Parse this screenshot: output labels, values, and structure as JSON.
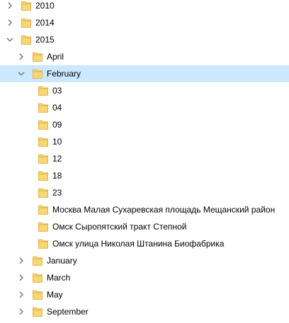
{
  "colors": {
    "selection": "#cce8ff",
    "folder_fill": "#f8d775",
    "folder_edge": "#e0b34a",
    "chevron": "#6b6b6b"
  },
  "tree": {
    "nodes": [
      {
        "label": "2010",
        "depth": 0,
        "state": "collapsed",
        "selected": false
      },
      {
        "label": "2014",
        "depth": 0,
        "state": "collapsed",
        "selected": false
      },
      {
        "label": "2015",
        "depth": 0,
        "state": "expanded",
        "selected": false
      },
      {
        "label": "April",
        "depth": 1,
        "state": "collapsed",
        "selected": false
      },
      {
        "label": "February",
        "depth": 1,
        "state": "expanded",
        "selected": true
      },
      {
        "label": "03",
        "depth": 2,
        "state": "leaf",
        "selected": false
      },
      {
        "label": "04",
        "depth": 2,
        "state": "leaf",
        "selected": false
      },
      {
        "label": "09",
        "depth": 2,
        "state": "leaf",
        "selected": false
      },
      {
        "label": "10",
        "depth": 2,
        "state": "leaf",
        "selected": false
      },
      {
        "label": "12",
        "depth": 2,
        "state": "leaf",
        "selected": false
      },
      {
        "label": "18",
        "depth": 2,
        "state": "leaf",
        "selected": false
      },
      {
        "label": "23",
        "depth": 2,
        "state": "leaf",
        "selected": false
      },
      {
        "label": "Москва Малая Сухаревская площадь Мещанский район",
        "depth": 2,
        "state": "leaf",
        "selected": false
      },
      {
        "label": "Омск Сыропятский тракт Степной",
        "depth": 2,
        "state": "leaf",
        "selected": false
      },
      {
        "label": "Омск улица Николая Штанина Биофабрика",
        "depth": 2,
        "state": "leaf",
        "selected": false
      },
      {
        "label": "January",
        "depth": 1,
        "state": "collapsed",
        "selected": false
      },
      {
        "label": "March",
        "depth": 1,
        "state": "collapsed",
        "selected": false
      },
      {
        "label": "May",
        "depth": 1,
        "state": "collapsed",
        "selected": false
      },
      {
        "label": "September",
        "depth": 1,
        "state": "collapsed",
        "selected": false
      }
    ]
  }
}
